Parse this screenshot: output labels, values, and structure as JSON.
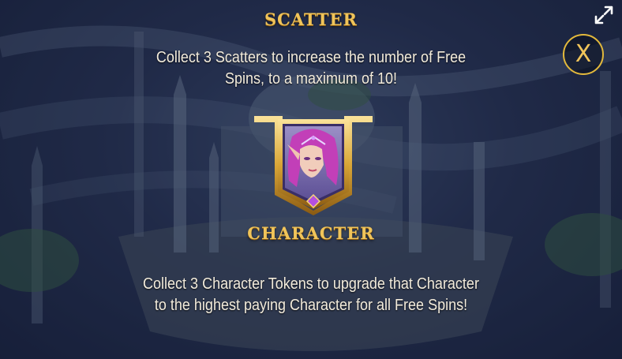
{
  "scatter": {
    "title": "SCATTER",
    "description_line1": "Collect 3 Scatters to increase the number of Free",
    "description_line2": "Spins, to a maximum of 10!"
  },
  "character": {
    "title": "CHARACTER",
    "description_line1": "Collect 3 Character Tokens to upgrade that Character",
    "description_line2": "to the highest paying Character for all Free Spins!",
    "portrait": "elf-sorceress-portrait"
  },
  "controls": {
    "close_label": "X",
    "fullscreen_icon": "expand-arrows-icon"
  },
  "colors": {
    "gold": "#f0c45a",
    "text": "#f3ecdc",
    "background": "#2a3556"
  }
}
